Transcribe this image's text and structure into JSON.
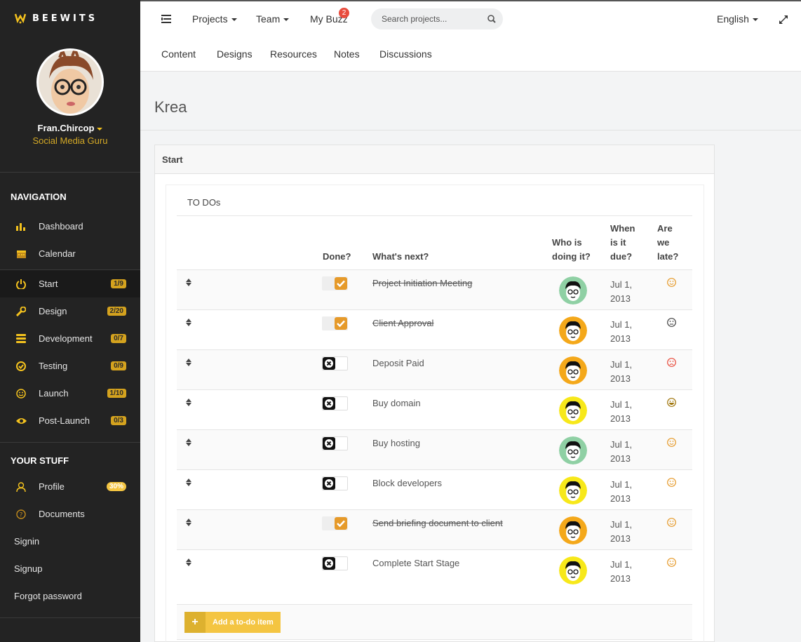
{
  "brand": {
    "name": "BEEWITS",
    "accent": "#f4c21e"
  },
  "user": {
    "name": "Fran.Chircop",
    "role": "Social Media Guru"
  },
  "sidebar": {
    "nav_heading": "NAVIGATION",
    "nav_items": [
      {
        "label": "Dashboard",
        "icon": "bar-chart-icon"
      },
      {
        "label": "Calendar",
        "icon": "calendar-icon"
      }
    ],
    "stages": [
      {
        "label": "Start",
        "badge": "1/9",
        "icon": "power-icon",
        "active": true
      },
      {
        "label": "Design",
        "badge": "2/20",
        "icon": "wrench-icon"
      },
      {
        "label": "Development",
        "badge": "0/7",
        "icon": "server-icon"
      },
      {
        "label": "Testing",
        "badge": "0/9",
        "icon": "check-circle-icon"
      },
      {
        "label": "Launch",
        "badge": "1/10",
        "icon": "smile-icon"
      },
      {
        "label": "Post-Launch",
        "badge": "0/3",
        "icon": "eye-icon"
      }
    ],
    "stuff_heading": "YOUR STUFF",
    "stuff_items": [
      {
        "label": "Profile",
        "badge": "30%",
        "icon": "user-icon"
      },
      {
        "label": "Documents",
        "icon": "question-circle-icon"
      }
    ],
    "plain_items": [
      "Signin",
      "Signup",
      "Forgot password"
    ]
  },
  "topnav": {
    "projects": "Projects",
    "team": "Team",
    "my_buzz": "My Buzz",
    "buzz_count": "2",
    "search_placeholder": "Search projects...",
    "language": "English"
  },
  "subnav": [
    "Content",
    "Designs",
    "Resources",
    "Notes",
    "Discussions"
  ],
  "page": {
    "title": "Krea",
    "panel_title": "Start",
    "list_title": "TO DOs"
  },
  "table": {
    "headers": {
      "done": "Done?",
      "next": "What's next?",
      "who": [
        "Who is",
        "doing it?"
      ],
      "when": [
        "When",
        "is it",
        "due?"
      ],
      "late": [
        "Are",
        "we",
        "late?"
      ]
    },
    "rows": [
      {
        "task": "Project Initiation Meeting",
        "done": true,
        "avatar": "green",
        "due": [
          "Jul 1,",
          "2013"
        ],
        "mood": "happy"
      },
      {
        "task": "Client Approval",
        "done": true,
        "avatar": "orange",
        "due": [
          "Jul 1,",
          "2013"
        ],
        "mood": "neutral"
      },
      {
        "task": "Deposit Paid",
        "done": false,
        "avatar": "orange",
        "due": [
          "Jul 1,",
          "2013"
        ],
        "mood": "sad"
      },
      {
        "task": "Buy domain",
        "done": false,
        "avatar": "yellow",
        "due": [
          "Jul 1,",
          "2013"
        ],
        "mood": "big-smile"
      },
      {
        "task": "Buy hosting",
        "done": false,
        "avatar": "green",
        "due": [
          "Jul 1,",
          "2013"
        ],
        "mood": "happy"
      },
      {
        "task": "Block developers",
        "done": false,
        "avatar": "yellow",
        "due": [
          "Jul 1,",
          "2013"
        ],
        "mood": "happy"
      },
      {
        "task": "Send briefing document to client",
        "done": true,
        "avatar": "orange",
        "due": [
          "Jul 1,",
          "2013"
        ],
        "mood": "happy"
      },
      {
        "task": "Complete Start Stage",
        "done": false,
        "avatar": "yellow",
        "due": [
          "Jul 1,",
          "2013"
        ],
        "mood": "happy"
      }
    ],
    "add_label": "Add a to-do item"
  }
}
